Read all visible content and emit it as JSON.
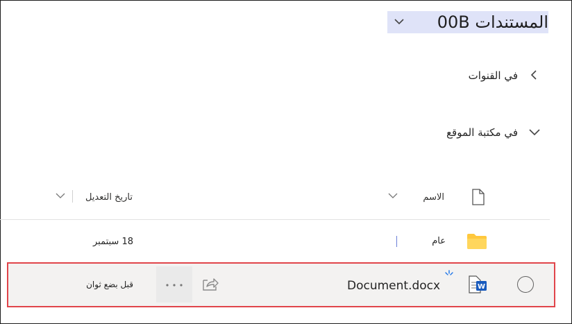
{
  "header": {
    "title": "المستندات 00B"
  },
  "sections": [
    {
      "label": "في القنوات",
      "expanded": false
    },
    {
      "label": "في مكتبة الموقع",
      "expanded": true
    }
  ],
  "columns": {
    "name": "الاسم",
    "modified": "تاريخ التعديل"
  },
  "rows": [
    {
      "name": "عام",
      "modified": "18 سبتمبر",
      "icon": "folder-icon"
    },
    {
      "name": "Document.docx",
      "modified": "قبل بضع ثوان",
      "icon": "word-doc-icon",
      "selected": true
    }
  ],
  "colors": {
    "selection_outline": "#e0444a",
    "title_highlight": "#dfe3f8",
    "folder": "#ffc83d",
    "word": "#185abd"
  }
}
